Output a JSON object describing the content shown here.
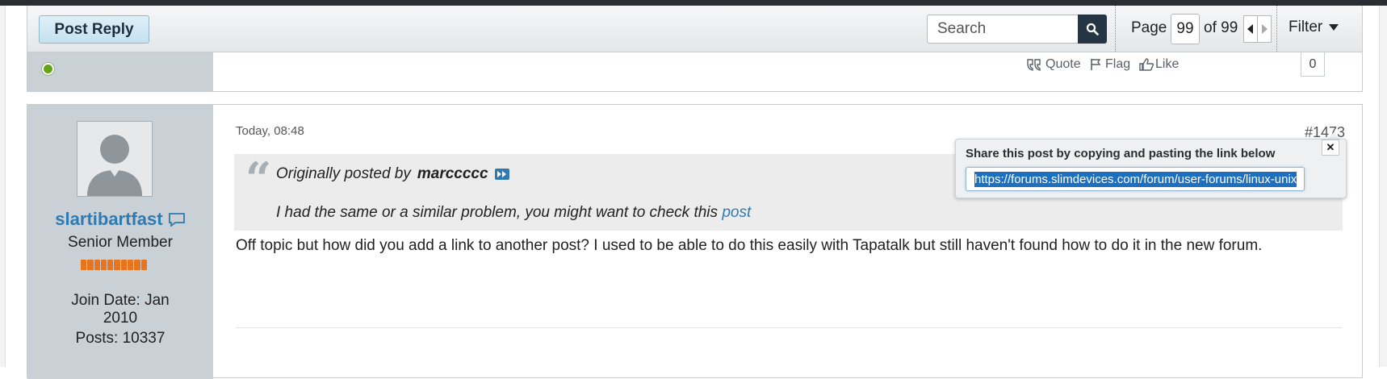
{
  "toolbar": {
    "post_reply_label": "Post Reply",
    "search_placeholder": "Search",
    "page_label": "Page",
    "page_current": "99",
    "page_of": "of 99",
    "filter_label": "Filter"
  },
  "prev_post": {
    "actions": {
      "quote": "Quote",
      "flag": "Flag",
      "like": "Like",
      "like_count": "0"
    }
  },
  "post": {
    "date": "Today, 08:48",
    "number": "#1473",
    "user": {
      "name": "slartibartfast",
      "title": "Senior Member",
      "join_date": "Join Date: Jan 2010",
      "posts": "Posts: 10337"
    },
    "quote": {
      "prefix": "Originally posted by",
      "author": "marccccc",
      "text": "I had the same or a similar problem, you might want to check this",
      "link_text": "post"
    },
    "body": "Off topic but how did you add a link to another post? I used to be able to do this easily with Tapatalk but still haven't found how to do it in the new forum."
  },
  "share_popup": {
    "title": "Share this post by copying and pasting the link below",
    "close": "✕",
    "url": "https://forums.slimdevices.com/forum/user-forums/linux-unix"
  },
  "colors": {
    "link": "#2f7ab0",
    "sidebar": "#c9d0d6",
    "online": "#63a317",
    "reputation": "#e8751e",
    "search_button": "#263544"
  }
}
